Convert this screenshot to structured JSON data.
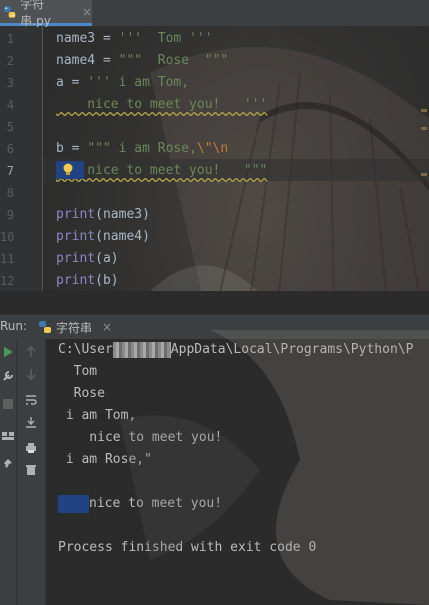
{
  "tab": {
    "title": "字符串.py",
    "close_glyph": "×"
  },
  "editor": {
    "line_numbers": [
      "1",
      "2",
      "3",
      "4",
      "5",
      "6",
      "7",
      "8",
      "9",
      "10",
      "11",
      "12"
    ],
    "current_line": "7",
    "lines": [
      {
        "parts": [
          {
            "t": "name3 = ",
            "c": "kw"
          },
          {
            "t": "'''  Tom '''",
            "c": "str"
          }
        ]
      },
      {
        "parts": [
          {
            "t": "name4 = ",
            "c": "kw"
          },
          {
            "t": "\"\"\"  Rose  \"\"\"",
            "c": "str"
          }
        ]
      },
      {
        "parts": [
          {
            "t": "a = ",
            "c": "kw"
          },
          {
            "t": "''' i am Tom,",
            "c": "str"
          }
        ]
      },
      {
        "parts": [
          {
            "t": "    nice to meet you!   '''",
            "c": "str"
          }
        ]
      },
      {
        "parts": []
      },
      {
        "parts": [
          {
            "t": "b = ",
            "c": "kw"
          },
          {
            "t": "\"\"\" i am Rose,",
            "c": "str"
          },
          {
            "t": "\\\"\\n",
            "c": "esc"
          }
        ]
      },
      {
        "parts": [
          {
            "t": "    nice to meet you!   \"\"\"",
            "c": "str"
          }
        ]
      },
      {
        "parts": []
      },
      {
        "parts": [
          {
            "t": "print",
            "c": "fn"
          },
          {
            "t": "(name3)",
            "c": "kw"
          }
        ]
      },
      {
        "parts": [
          {
            "t": "print",
            "c": "fn"
          },
          {
            "t": "(name4)",
            "c": "kw"
          }
        ]
      },
      {
        "parts": [
          {
            "t": "print",
            "c": "fn"
          },
          {
            "t": "(a)",
            "c": "kw"
          }
        ]
      },
      {
        "parts": [
          {
            "t": "print",
            "c": "fn"
          },
          {
            "t": "(b)",
            "c": "kw"
          }
        ]
      }
    ]
  },
  "run": {
    "label": "Run:",
    "tab_title": "字符串",
    "close_glyph": "×",
    "path_prefix": "C:\\User",
    "path_suffix": "AppData\\Local\\Programs\\Python\\P",
    "output_lines": [
      "  Tom",
      "  Rose",
      " i am Tom,",
      "    nice to meet you!",
      " i am Rose,\"",
      "",
      "",
      "",
      "Process finished with exit code 0"
    ],
    "selected_line_text": "nice to meet you!"
  },
  "colors": {
    "accent": "#4a88c7",
    "string": "#6a8759",
    "builtin": "#8888c6",
    "escape": "#cc7832",
    "selection": "#214283"
  }
}
